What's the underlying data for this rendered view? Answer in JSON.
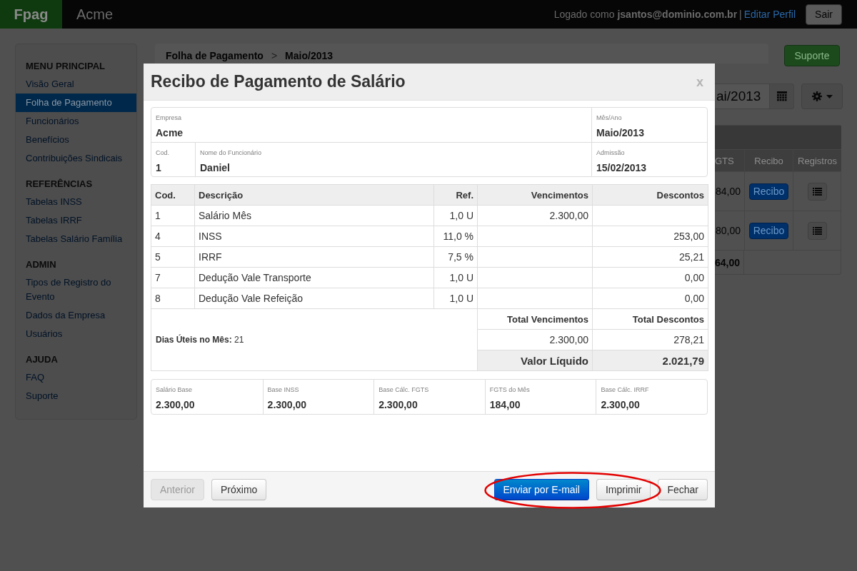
{
  "topbar": {
    "brand": "Fpag",
    "company": "Acme",
    "session": "Logado como **jsantos@dominio.com.br**",
    "separator": "|",
    "profile_link": "Editar Perfil",
    "logout_button": "Sair"
  },
  "sidebar": {
    "sections": [
      {
        "title": "MENU PRINCIPAL",
        "items": [
          {
            "label": "Visão Geral",
            "selected": false
          },
          {
            "label": "Folha de Pagamento",
            "selected": true
          },
          {
            "label": "Funcionários",
            "selected": false
          },
          {
            "label": "Benefícios",
            "selected": false
          },
          {
            "label": "Contribuições Sindicais",
            "selected": false
          }
        ]
      },
      {
        "title": "REFERÊNCIAS",
        "items": [
          {
            "label": "Tabelas INSS",
            "selected": false
          },
          {
            "label": "Tabelas IRRF",
            "selected": false
          },
          {
            "label": "Tabelas Salário Família",
            "selected": false
          }
        ]
      },
      {
        "title": "ADMIN",
        "items": [
          {
            "label": "Tipos de Registro do Evento",
            "selected": false
          },
          {
            "label": "Dados da Empresa",
            "selected": false
          },
          {
            "label": "Usuários",
            "selected": false
          }
        ]
      },
      {
        "title": "AJUDA",
        "items": [
          {
            "label": "FAQ",
            "selected": false
          },
          {
            "label": "Suporte",
            "selected": false
          }
        ]
      }
    ]
  },
  "breadcrumb": {
    "items": [
      "Folha de Pagamento",
      "Maio/2013"
    ],
    "separator": ">"
  },
  "support_button": "Suporte",
  "period_field": {
    "value": "ai/2013"
  },
  "payroll_table": {
    "columns": [
      "GTS",
      "Recibo",
      "Registros"
    ],
    "rows": [
      {
        "column_1": "84,00",
        "receipt_button": "Recibo"
      },
      {
        "column_1": "80,00",
        "receipt_button": "Recibo"
      }
    ],
    "total": "64,00"
  },
  "modal": {
    "title": "Recibo de Pagamento de Salário",
    "close_button": "x",
    "info_rows": [
      {
        "fields": [
          {
            "label": "Empresa",
            "value": "Acme"
          },
          {
            "label": "Mês/Ano",
            "value": "Maio/2013"
          }
        ]
      },
      {
        "fields": [
          {
            "label": "Cod.",
            "value": "1"
          },
          {
            "label": "Nome do Funcionário",
            "value": "Daniel"
          },
          {
            "label": "Admissão",
            "value": "15/02/2013"
          }
        ]
      }
    ],
    "items_table": {
      "columns": [
        "Cod.",
        "Descrição",
        "Ref.",
        "Vencimentos",
        "Descontos"
      ],
      "rows": [
        {
          "code": "1",
          "description": "Salário Mês",
          "ref": "1,0 U",
          "earnings": "2.300,00"
        },
        {
          "code": "4",
          "description": "INSS",
          "ref": "11,0 %",
          "deductions": "253,00"
        },
        {
          "code": "5",
          "description": "IRRF",
          "ref": "7,5 %",
          "deductions": "25,21"
        },
        {
          "code": "7",
          "description": "Dedução Vale Transporte",
          "ref": "1,0 U",
          "deductions": "0,00"
        },
        {
          "code": "8",
          "description": "Dedução Vale Refeição",
          "ref": "1,0 U",
          "deductions": "0,00"
        }
      ]
    },
    "summary": {
      "working_days": "**Dias Úteis no Mês:** 21",
      "total_earnings_label": "Total Vencimentos",
      "total_deductions_label": "Total Descontos",
      "total_earnings": "2.300,00",
      "total_deductions": "278,21",
      "net_label": "Valor Líquido",
      "net_value": "2.021,79"
    },
    "bases": [
      {
        "label": "Salário Base",
        "value": "2.300,00"
      },
      {
        "label": "Base INSS",
        "value": "2.300,00"
      },
      {
        "label": "Base Cálc. FGTS",
        "value": "2.300,00"
      },
      {
        "label": "FGTS do Mês",
        "value": "184,00"
      },
      {
        "label": "Base Cálc. IRRF",
        "value": "2.300,00"
      }
    ],
    "footer": {
      "left_buttons": [
        {
          "label": "Anterior",
          "kind": "default",
          "disabled": true,
          "highlighted": false
        },
        {
          "label": "Próximo",
          "kind": "default",
          "disabled": false,
          "highlighted": false
        }
      ],
      "right_buttons": [
        {
          "label": "Enviar por E-mail",
          "kind": "primary",
          "disabled": false,
          "highlighted": true
        },
        {
          "label": "Imprimir",
          "kind": "default",
          "disabled": false,
          "highlighted": true
        },
        {
          "label": "Fechar",
          "kind": "default",
          "disabled": false,
          "highlighted": false
        }
      ]
    }
  }
}
